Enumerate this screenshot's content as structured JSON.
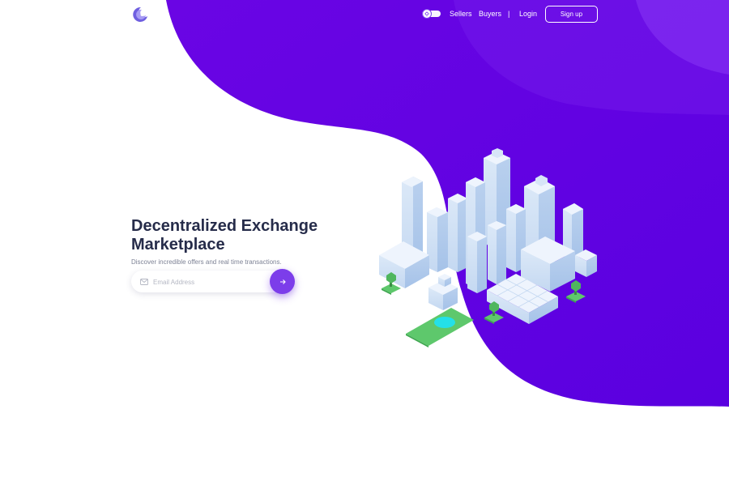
{
  "nav": {
    "items": [
      {
        "label": "Sellers"
      },
      {
        "label": "Buyers"
      }
    ],
    "divider": "|",
    "login_label": "Login",
    "signup_label": "Sign up"
  },
  "hero": {
    "title": "Decentralized Exchange Marketplace",
    "subtitle": "Discover incredible offers and real time transactions."
  },
  "email_form": {
    "placeholder": "Email Address",
    "value": ""
  },
  "icons": {
    "logo": "logo-mark-icon",
    "theme_toggle": "sun-icon",
    "email": "mail-icon",
    "submit": "arrow-right-icon"
  },
  "colors": {
    "brand_purple": "#6a05e4",
    "accent_button": "#7c3dea",
    "title_text": "#262c4a",
    "tree_green": "#5ec86c",
    "pond": "#24e0e8",
    "building_light": "#dbe8f8"
  }
}
